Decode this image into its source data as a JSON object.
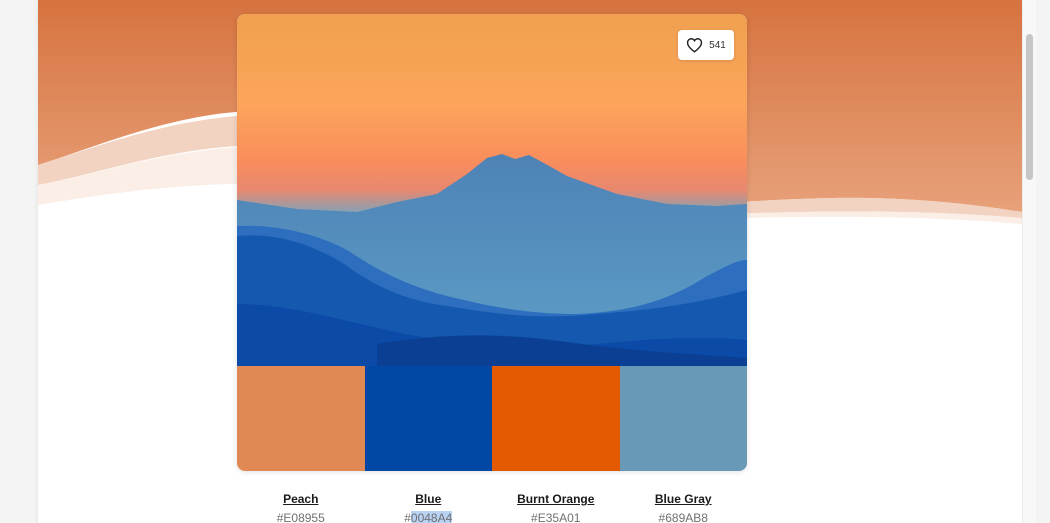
{
  "colors": {
    "hero_top": "#d6733f",
    "hero_bottom": "#e8a17a",
    "sky_top": "#f0a050",
    "sky_mid": "#fca55a",
    "sky_low": "#f78a68"
  },
  "like": {
    "icon": "heart-outline-icon",
    "count": "541"
  },
  "palette": [
    {
      "name": "Peach",
      "hex_prefix": "#",
      "hex_value": "E08955",
      "color": "#E08955"
    },
    {
      "name": "Blue",
      "hex_prefix": "#",
      "hex_value": "0048A4",
      "color": "#0048A4"
    },
    {
      "name": "Burnt Orange",
      "hex_prefix": "#",
      "hex_value": "E35A01",
      "color": "#E35A01"
    },
    {
      "name": "Blue Gray",
      "hex_prefix": "#",
      "hex_value": "689AB8",
      "color": "#689AB8"
    }
  ]
}
